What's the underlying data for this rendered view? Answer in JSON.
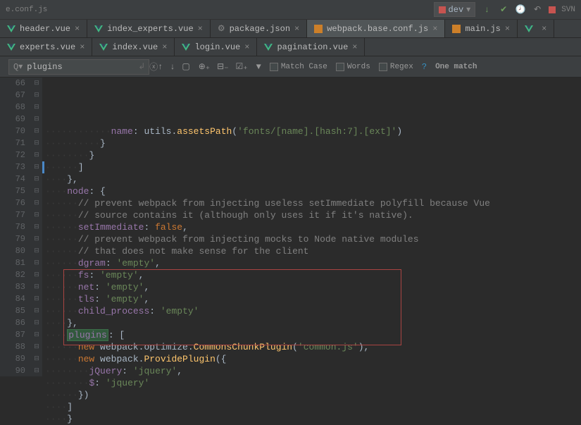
{
  "topbar": {
    "leftText": "e.conf.js",
    "branch": "dev",
    "svn": "SVN"
  },
  "tabsRow1": [
    {
      "label": "header.vue",
      "type": "vue"
    },
    {
      "label": "index_experts.vue",
      "type": "vue"
    },
    {
      "label": "package.json",
      "type": "json"
    },
    {
      "label": "webpack.base.conf.js",
      "type": "js",
      "active": true
    },
    {
      "label": "main.js",
      "type": "js"
    },
    {
      "label": "",
      "type": "vue"
    }
  ],
  "tabsRow2": [
    {
      "label": "experts.vue",
      "type": "vue"
    },
    {
      "label": "index.vue",
      "type": "vue"
    },
    {
      "label": "login.vue",
      "type": "vue"
    },
    {
      "label": "pagination.vue",
      "type": "vue"
    }
  ],
  "search": {
    "query": "plugins",
    "matchCase": "Match Case",
    "words": "Words",
    "regex": "Regex",
    "result": "One match"
  },
  "code": {
    "startLine": 66,
    "lines": [
      {
        "n": 66,
        "html": "<span class='ws'>········</span><span class='prop'>name</span>: utils.<span class='fn'>assetsPath</span>(<span class='str'>'fonts/[name].[hash:7].[ext]'</span>)"
      },
      {
        "n": 67,
        "html": "<span class='ws'>······</span>}"
      },
      {
        "n": 68,
        "html": "<span class='ws'>····</span>}"
      },
      {
        "n": 69,
        "html": "<span class='ws'>··</span>]"
      },
      {
        "n": 70,
        "html": "},"
      },
      {
        "n": 71,
        "html": "<span class='prop'>node</span>: {"
      },
      {
        "n": 72,
        "html": "<span class='ws'>··</span><span class='comment'>// prevent webpack from injecting useless setImmediate polyfill because Vue</span>"
      },
      {
        "n": 73,
        "html": "<span class='ws'>··</span><span class='comment'>// source contains it (although only uses it if it's native).</span>"
      },
      {
        "n": 74,
        "html": "<span class='ws'>··</span><span class='prop'>setImmediate</span>: <span class='kw'>false</span>,"
      },
      {
        "n": 75,
        "html": "<span class='ws'>··</span><span class='comment'>// prevent webpack from injecting mocks to Node native modules</span>"
      },
      {
        "n": 76,
        "html": "<span class='ws'>··</span><span class='comment'>// that does not make sense for the client</span>"
      },
      {
        "n": 77,
        "html": "<span class='ws'>··</span><span class='prop'>dgram</span>: <span class='str'>'empty'</span>,"
      },
      {
        "n": 78,
        "html": "<span class='ws'>··</span><span class='prop'>fs</span>: <span class='str'>'empty'</span>,"
      },
      {
        "n": 79,
        "html": "<span class='ws'>··</span><span class='prop'>net</span>: <span class='str'>'empty'</span>,"
      },
      {
        "n": 80,
        "html": "<span class='ws'>··</span><span class='prop'>tls</span>: <span class='str'>'empty'</span>,"
      },
      {
        "n": 81,
        "html": "<span class='ws'>··</span><span class='prop'>child_process</span>: <span class='str'>'empty'</span>"
      },
      {
        "n": 82,
        "html": "},"
      },
      {
        "n": 83,
        "html": "<span class='hl-search'><span class='prop'>plugins</span></span>: ["
      },
      {
        "n": 84,
        "html": "<span class='ws'>··</span><span class='kw'>new</span> webpack.optimize.<span class='fn'>CommonsChunkPlugin</span>(<span class='str'>'common.js'</span>),"
      },
      {
        "n": 85,
        "html": "<span class='ws'>··</span><span class='kw'>new</span> webpack.<span class='fn'>ProvidePlugin</span>({"
      },
      {
        "n": 86,
        "html": "<span class='ws'>····</span><span class='prop'>jQuery</span>: <span class='str'>'jquery'</span>,"
      },
      {
        "n": 87,
        "html": "<span class='ws'>····</span><span class='prop'>$</span>: <span class='str'>'jquery'</span>"
      },
      {
        "n": 88,
        "html": "<span class='ws'>··</span>})"
      },
      {
        "n": 89,
        "html": "]"
      },
      {
        "n": 90,
        "html": "}"
      }
    ]
  }
}
